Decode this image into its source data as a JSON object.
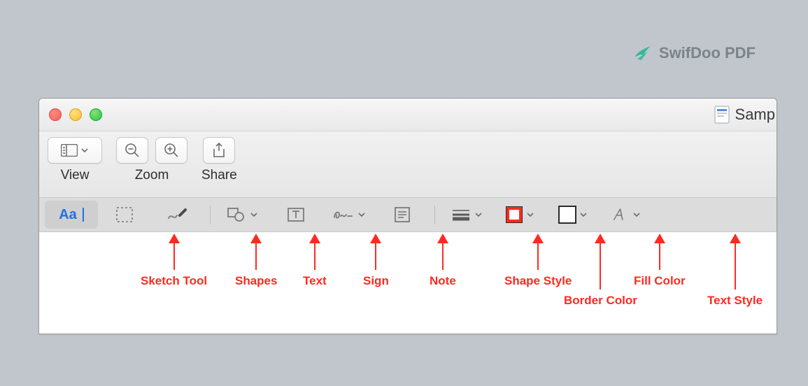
{
  "watermark": {
    "label": "SwifDoo PDF"
  },
  "window": {
    "doc_title": "Samp"
  },
  "main_toolbar": {
    "groups": {
      "view": {
        "label": "View"
      },
      "zoom": {
        "label": "Zoom"
      },
      "share": {
        "label": "Share"
      }
    }
  },
  "markup_toolbar": {
    "text_select_glyph": "Aa"
  },
  "annotations": {
    "sketch": {
      "label": "Sketch Tool"
    },
    "shapes": {
      "label": "Shapes"
    },
    "text": {
      "label": "Text"
    },
    "sign": {
      "label": "Sign"
    },
    "note": {
      "label": "Note"
    },
    "shape_style": {
      "label": "Shape Style"
    },
    "border_color": {
      "label": "Border Color"
    },
    "fill_color": {
      "label": "Fill Color"
    },
    "text_style": {
      "label": "Text Style"
    }
  }
}
